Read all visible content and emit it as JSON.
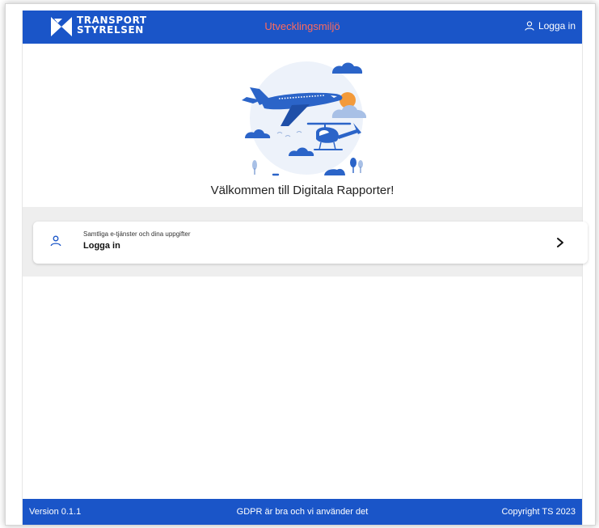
{
  "header": {
    "logo": {
      "line1": "TRANSPORT",
      "line2": "STYRELSEN"
    },
    "environment": "Utvecklingsmiljö",
    "login_label": "Logga in",
    "login_icon": "user-icon"
  },
  "hero": {
    "illustration": "airplane-helicopter-clouds-illustration",
    "welcome_text": "Välkommen till Digitala Rapporter!"
  },
  "login_card": {
    "icon": "user-icon",
    "subtitle": "Samtliga e-tjänster och dina uppgifter",
    "title": "Logga in",
    "chevron_icon": "chevron-right-icon"
  },
  "footer": {
    "version": "Version 0.1.1",
    "gdpr": "GDPR är bra och vi använder det",
    "copyright": "Copyright TS 2023"
  },
  "colors": {
    "primary": "#1a55c8",
    "environment_text": "#ff6a5c",
    "card_area_bg": "#eeeeee",
    "illustration_blue": "#2b64c8",
    "illustration_sun": "#f39a3a"
  }
}
